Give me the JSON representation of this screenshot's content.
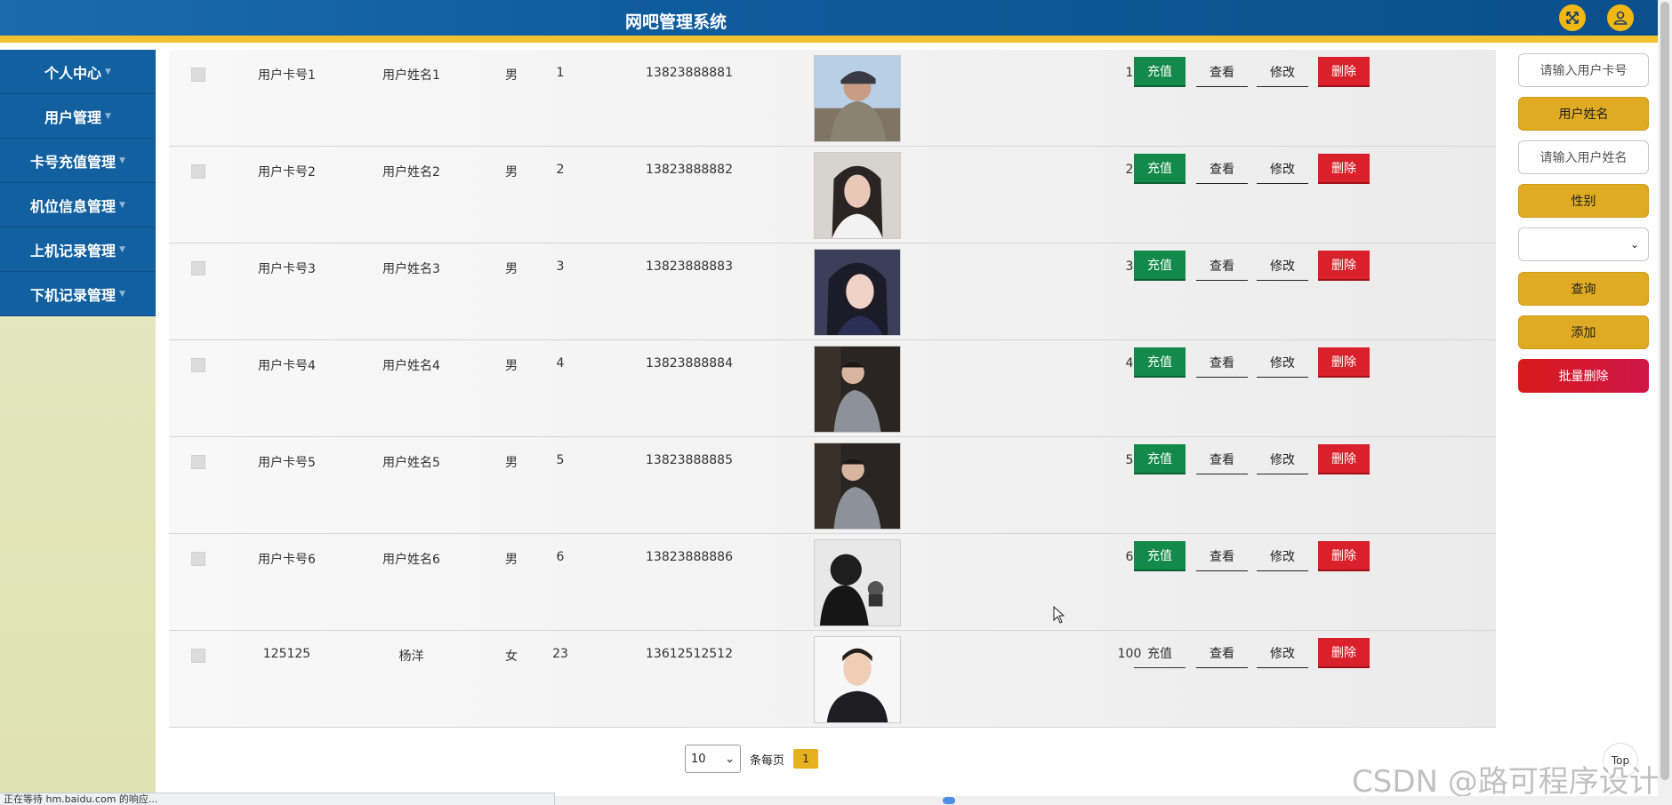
{
  "app": {
    "title": "网吧管理系统"
  },
  "header": {
    "fullscreen_icon": "expand-icon",
    "user_icon": "user-icon"
  },
  "sidebar": {
    "items": [
      {
        "label": "个人中心"
      },
      {
        "label": "用户管理"
      },
      {
        "label": "卡号充值管理"
      },
      {
        "label": "机位信息管理"
      },
      {
        "label": "上机记录管理"
      },
      {
        "label": "下机记录管理"
      }
    ]
  },
  "table": {
    "actions": {
      "recharge": "充值",
      "view": "查看",
      "edit": "修改",
      "delete": "删除"
    },
    "rows": [
      {
        "card": "用户卡号1",
        "name": "用户姓名1",
        "sex": "男",
        "age": "1",
        "phone": "13823888881",
        "balance": "1",
        "photo": "hooded-person"
      },
      {
        "card": "用户卡号2",
        "name": "用户姓名2",
        "sex": "男",
        "age": "2",
        "phone": "13823888882",
        "balance": "2",
        "photo": "long-hair-woman"
      },
      {
        "card": "用户卡号3",
        "name": "用户姓名3",
        "sex": "男",
        "age": "3",
        "phone": "13823888883",
        "balance": "3",
        "photo": "bob-hair-woman"
      },
      {
        "card": "用户卡号4",
        "name": "用户姓名4",
        "sex": "男",
        "age": "4",
        "phone": "13823888884",
        "balance": "4",
        "photo": "man-dark-wall"
      },
      {
        "card": "用户卡号5",
        "name": "用户姓名5",
        "sex": "男",
        "age": "5",
        "phone": "13823888885",
        "balance": "5",
        "photo": "man-dark-wall"
      },
      {
        "card": "用户卡号6",
        "name": "用户姓名6",
        "sex": "男",
        "age": "6",
        "phone": "13823888886",
        "balance": "6",
        "photo": "silhouette-bw"
      },
      {
        "card": "125125",
        "name": "杨洋",
        "sex": "女",
        "age": "23",
        "phone": "13612512512",
        "balance": "100",
        "photo": "man-portrait"
      }
    ]
  },
  "search": {
    "card_placeholder": "请输入用户卡号",
    "name_label": "用户姓名",
    "name_placeholder": "请输入用户姓名",
    "sex_label": "性别",
    "sex_selected": "",
    "query_button": "查询",
    "add_button": "添加",
    "batch_delete_button": "批量删除"
  },
  "pagination": {
    "page_size": "10",
    "per_page_label": "条每页",
    "current_page": "1"
  },
  "status_bar": {
    "text": "正在等待 hm.baidu.com 的响应..."
  },
  "back_to_top": {
    "label": "Top"
  },
  "watermark": {
    "text": "CSDN @路可程序设计"
  },
  "colors": {
    "header": "#12609f",
    "accent": "#f0c232",
    "recharge": "#138a4a",
    "delete": "#d9202b",
    "search_yellow": "#e0ab22"
  }
}
